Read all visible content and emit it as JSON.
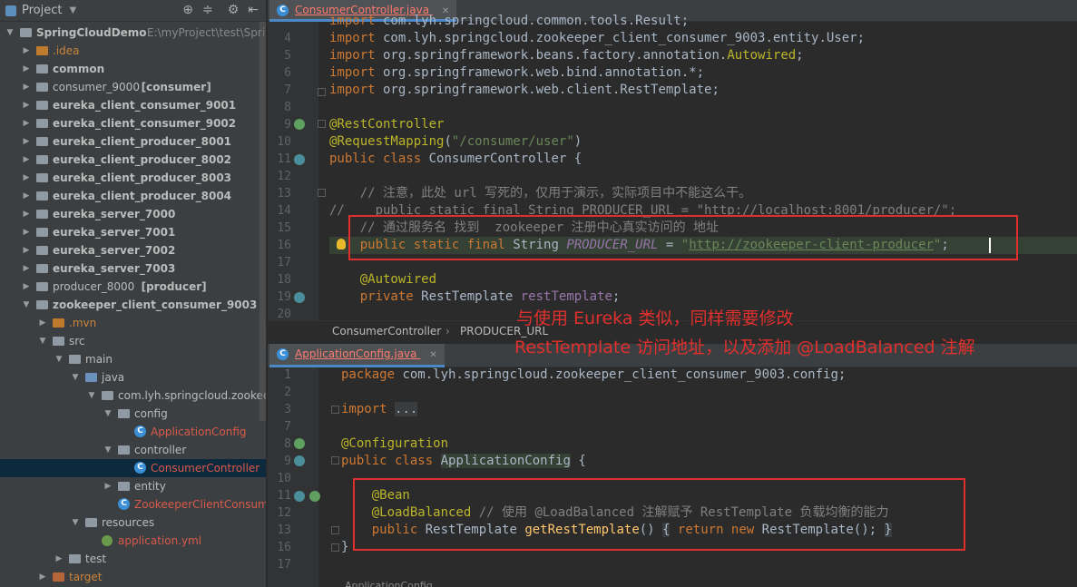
{
  "project_panel": {
    "title": "Project",
    "tree": [
      {
        "label": "SpringCloudDemo",
        "suffix": "E:\\myProject\\test\\Sprin",
        "depth": 0,
        "open": true,
        "icon": "module-folder-icon",
        "bold": true
      },
      {
        "label": ".idea",
        "depth": 1,
        "open": false,
        "icon": "folder-icon",
        "style": "orange"
      },
      {
        "label": "common",
        "depth": 1,
        "open": false,
        "icon": "module-folder-icon",
        "bold": true
      },
      {
        "label": "consumer_9000",
        "module": "[consumer]",
        "depth": 1,
        "open": false,
        "icon": "module-folder-icon"
      },
      {
        "label": "eureka_client_consumer_9001",
        "depth": 1,
        "open": false,
        "icon": "module-folder-icon",
        "bold": true
      },
      {
        "label": "eureka_client_consumer_9002",
        "depth": 1,
        "open": false,
        "icon": "module-folder-icon",
        "bold": true
      },
      {
        "label": "eureka_client_producer_8001",
        "depth": 1,
        "open": false,
        "icon": "module-folder-icon",
        "bold": true
      },
      {
        "label": "eureka_client_producer_8002",
        "depth": 1,
        "open": false,
        "icon": "module-folder-icon",
        "bold": true
      },
      {
        "label": "eureka_client_producer_8003",
        "depth": 1,
        "open": false,
        "icon": "module-folder-icon",
        "bold": true
      },
      {
        "label": "eureka_client_producer_8004",
        "depth": 1,
        "open": false,
        "icon": "module-folder-icon",
        "bold": true
      },
      {
        "label": "eureka_server_7000",
        "depth": 1,
        "open": false,
        "icon": "module-folder-icon",
        "bold": true
      },
      {
        "label": "eureka_server_7001",
        "depth": 1,
        "open": false,
        "icon": "module-folder-icon",
        "bold": true
      },
      {
        "label": "eureka_server_7002",
        "depth": 1,
        "open": false,
        "icon": "module-folder-icon",
        "bold": true
      },
      {
        "label": "eureka_server_7003",
        "depth": 1,
        "open": false,
        "icon": "module-folder-icon",
        "bold": true
      },
      {
        "label": "producer_8000",
        "module": "[producer]",
        "depth": 1,
        "open": false,
        "icon": "module-folder-icon"
      },
      {
        "label": "zookeeper_client_consumer_9003",
        "depth": 1,
        "open": true,
        "icon": "module-folder-icon",
        "bold": true
      },
      {
        "label": ".mvn",
        "depth": 2,
        "open": false,
        "icon": "folder-icon",
        "style": "orange"
      },
      {
        "label": "src",
        "depth": 2,
        "open": true,
        "icon": "folder-icon"
      },
      {
        "label": "main",
        "depth": 3,
        "open": true,
        "icon": "folder-icon"
      },
      {
        "label": "java",
        "depth": 4,
        "open": true,
        "icon": "source-folder-icon"
      },
      {
        "label": "com.lyh.springcloud.zookee",
        "depth": 5,
        "open": true,
        "icon": "package-icon"
      },
      {
        "label": "config",
        "depth": 6,
        "open": true,
        "icon": "package-icon"
      },
      {
        "label": "ApplicationConfig",
        "depth": 7,
        "leaf": true,
        "icon": "java-class-icon",
        "style": "red"
      },
      {
        "label": "controller",
        "depth": 6,
        "open": true,
        "icon": "package-icon"
      },
      {
        "label": "ConsumerController",
        "depth": 7,
        "leaf": true,
        "icon": "java-class-icon",
        "style": "red",
        "selected": true
      },
      {
        "label": "entity",
        "depth": 6,
        "open": false,
        "icon": "package-icon"
      },
      {
        "label": "ZookeeperClientConsume",
        "depth": 6,
        "leaf": true,
        "icon": "spring-boot-class-icon",
        "style": "red"
      },
      {
        "label": "resources",
        "depth": 4,
        "open": true,
        "icon": "resources-folder-icon"
      },
      {
        "label": "application.yml",
        "depth": 5,
        "leaf": true,
        "icon": "yaml-file-icon",
        "style": "red"
      },
      {
        "label": "test",
        "depth": 3,
        "open": false,
        "icon": "folder-icon"
      },
      {
        "label": "target",
        "depth": 2,
        "open": false,
        "icon": "folder-icon",
        "style": "orange"
      }
    ]
  },
  "editor_top": {
    "tab": "ConsumerController.java",
    "lines": [
      {
        "n": "",
        "html": "<span class='kw'>import</span> com.lyh.springcloud.common.tools.Result;"
      },
      {
        "n": "4",
        "html": "<span class='kw'>import</span> com.lyh.springcloud.zookeeper_client_consumer_9003.entity.User;"
      },
      {
        "n": "5",
        "html": "<span class='kw'>import</span> org.springframework.beans.factory.annotation.<span class='an'>Autowired</span>;"
      },
      {
        "n": "6",
        "html": "<span class='kw'>import</span> org.springframework.web.bind.annotation.*;"
      },
      {
        "n": "7",
        "html": "<span class='kw'>import</span> org.springframework.web.client.RestTemplate;"
      },
      {
        "n": "8",
        "html": ""
      },
      {
        "n": "9",
        "html": "<span class='an'>@RestController</span>"
      },
      {
        "n": "10",
        "html": "<span class='an'>@RequestMapping</span>(<span class='st'>\"/consumer/user\"</span>)"
      },
      {
        "n": "11",
        "html": "<span class='kw'>public class</span> ConsumerController {"
      },
      {
        "n": "12",
        "html": ""
      },
      {
        "n": "13",
        "html": "    <span class='cm'>// 注意，此处 url 写死的，仅用于演示，实际项目中不能这么干。</span>"
      },
      {
        "n": "14",
        "html": "<span class='cm'>//    public static final String PRODUCER_URL = \"http://localhost:8001/producer/\";</span>"
      },
      {
        "n": "15",
        "html": "    <span class='cm'>// 通过服务名 找到  zookeeper 注册中心真实访问的 地址</span>"
      },
      {
        "n": "16",
        "html": "    <span class='kw'>public static final</span> String <span class='fld'><i>PRODUCER_URL</i></span> = <span class='st'>\"<u>http://zookeeper-client-producer</u>\"</span>;"
      },
      {
        "n": "17",
        "html": ""
      },
      {
        "n": "18",
        "html": "    <span class='an'>@Autowired</span>"
      },
      {
        "n": "19",
        "html": "    <span class='kw'>private</span> RestTemplate <span class='fld'>restTemplate</span>;"
      },
      {
        "n": "20",
        "html": ""
      }
    ],
    "breadcrumb": [
      "ConsumerController",
      "PRODUCER_URL"
    ]
  },
  "annotation_note": {
    "line1": "与使用 Eureka 类似，同样需要修改",
    "line2": "RestTemplate 访问地址，以及添加 @LoadBalanced 注解"
  },
  "editor_bottom": {
    "tab": "ApplicationConfig.java",
    "lines": [
      {
        "n": "1",
        "html": "<span class='kw'>package</span> com.lyh.springcloud.zookeeper_client_consumer_9003.config;"
      },
      {
        "n": "2",
        "html": ""
      },
      {
        "n": "3",
        "html": "<span class='kw'>import</span> <span style='background:#3a3d3f;color:#a9b7c6'>...</span>"
      },
      {
        "n": "7",
        "html": ""
      },
      {
        "n": "8",
        "html": "<span class='an'>@Configuration</span>"
      },
      {
        "n": "9",
        "html": "<span class='kw'>public class</span> <span style='background:#344134'>ApplicationConfig</span> {"
      },
      {
        "n": "10",
        "html": ""
      },
      {
        "n": "11",
        "html": "    <span class='an'>@Bean</span>"
      },
      {
        "n": "12",
        "html": "    <span class='an'>@LoadBalanced</span> <span class='cm'>// 使用 @LoadBalanced 注解赋予 RestTemplate 负载均衡的能力</span>"
      },
      {
        "n": "13",
        "html": "    <span class='kw'>public</span> RestTemplate <span class='fn'>getRestTemplate</span>() <span style='background:#3a3d3f'>{</span> <span class='kw'>return new</span> RestTemplate(); <span style='background:#3a3d3f'>}</span>"
      },
      {
        "n": "16",
        "html": "}"
      },
      {
        "n": "17",
        "html": ""
      }
    ],
    "breadcrumb_partial": "ApplicationConfig"
  }
}
